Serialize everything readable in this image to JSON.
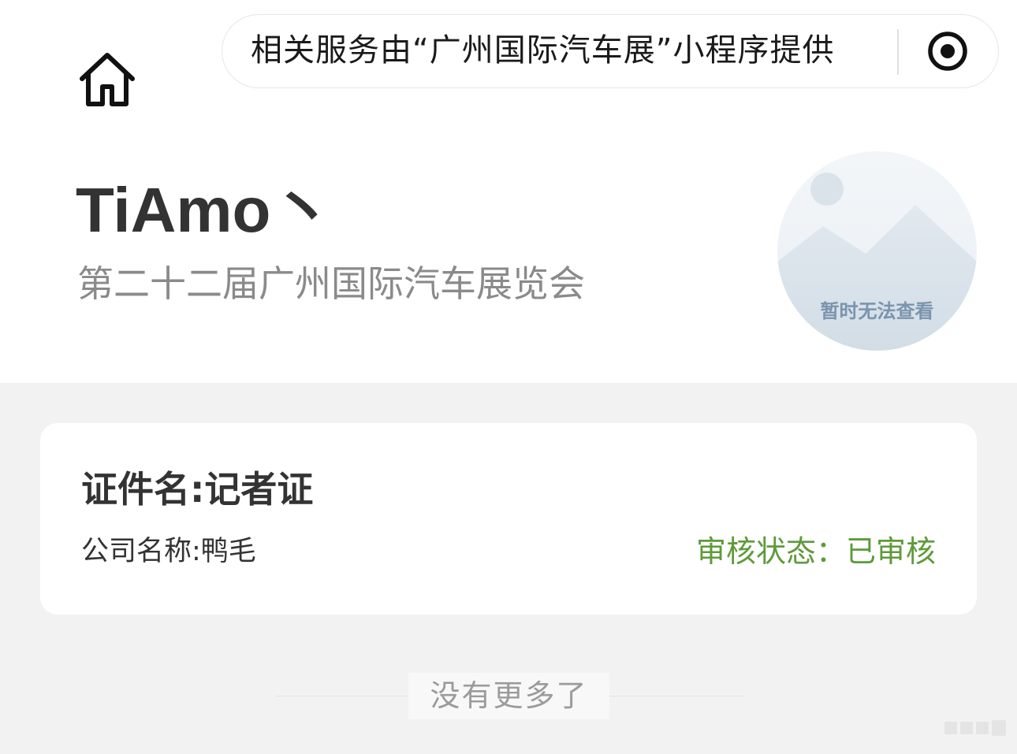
{
  "header": {
    "home_icon": "home-icon",
    "capsule_text": "相关服务由“广州国际汽车展”小程序提供",
    "capsule_icon": "target-icon"
  },
  "profile": {
    "name": "TiAmo丶",
    "event": "第二十二届广州国际汽车展览会",
    "avatar_caption": "暂时无法查看",
    "avatar_icon": "image-placeholder-icon"
  },
  "card": {
    "title": "证件名:记者证",
    "company": "公司名称:鸭毛",
    "status": "审核状态：已审核"
  },
  "footer": {
    "end_text": "没有更多了"
  },
  "colors": {
    "status_green": "#5f9a3a",
    "page_bg": "#f2f2f2"
  }
}
